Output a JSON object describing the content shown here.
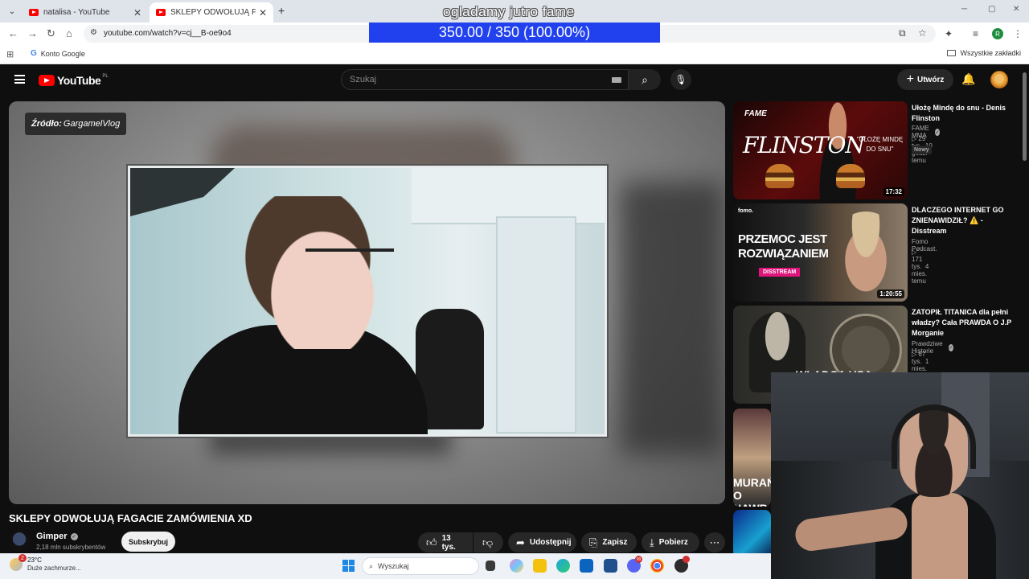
{
  "browser": {
    "tabs": [
      {
        "title": "natalisa - YouTube"
      },
      {
        "title": "SKLEPY ODWOŁUJĄ FAGACIE ZAMÓWIENIA XD"
      }
    ],
    "url": "youtube.com/watch?v=cj__B-oe9o4",
    "profile_initial": "R",
    "bookmarks": [
      {
        "label": "Konto Google"
      }
    ],
    "all_bookmarks_label": "Wszystkie zakładki"
  },
  "stream_overlay": {
    "title": "ogladamy jutro fame",
    "progress_text": "350.00 / 350 (100.00%)",
    "progress_value": 1.0
  },
  "youtube": {
    "logo": "YouTube",
    "region": "PL",
    "search_placeholder": "Szukaj",
    "create_label": "Utwórz"
  },
  "video": {
    "source_label": "Źródło:",
    "source_name": "GargamelVlog",
    "title": "SKLEPY ODWOŁUJĄ FAGACIE ZAMÓWIENIA XD",
    "channel": "Gimper",
    "subscribers": "2,18 mln subskrybentów",
    "subscribe_label": "Subskrybuj",
    "likes": "13 tys.",
    "share_label": "Udostępnij",
    "save_label": "Zapisz",
    "download_label": "Pobierz"
  },
  "recommendations": [
    {
      "title": "Ułożę Mindę do snu - Denis Flinston",
      "channel": "FAME MMA",
      "verified": true,
      "views": "29 tys.",
      "age": "10 godz. temu",
      "badge": "Nowy",
      "duration": "17:32",
      "thumb_text": "FLINSTON",
      "thumb_brand": "FAME",
      "thumb_quote": "\"UŁOŻĘ MINDĘ DO SNU\""
    },
    {
      "title": "DLACZEGO INTERNET GO ZNIENAWIDZIŁ? ⚠️ - Disstream",
      "channel": "Fomo Pødcast.",
      "verified": false,
      "views": "171 tys.",
      "age": "4 mies. temu",
      "duration": "1:20:55",
      "thumb_text": "PRZEMOC JEST ROZWIĄZANIEM",
      "thumb_tag": "DISSTREAM",
      "thumb_brand": "fomo."
    },
    {
      "title": "ZATOPIŁ TITANICA dla pełni władzy? Cała PRAWDA O J.P Morganie",
      "channel": "Prawdziwe Historie",
      "verified": true,
      "views": "67 tys.",
      "age": "1 mies. temu",
      "thumb_text": "WŁADCA USA"
    },
    {
      "thumb_text": "MURAŃ O NAWR"
    },
    {}
  ],
  "taskbar": {
    "temperature": "23°C",
    "condition": "Duże zachmurze...",
    "weather_badge": "2",
    "search_placeholder": "Wyszukaj",
    "discord_badge": "99"
  },
  "colors": {
    "overlay_bar": "#2141ee",
    "youtube_red": "#ff0000",
    "background": "#0f0f0f"
  }
}
